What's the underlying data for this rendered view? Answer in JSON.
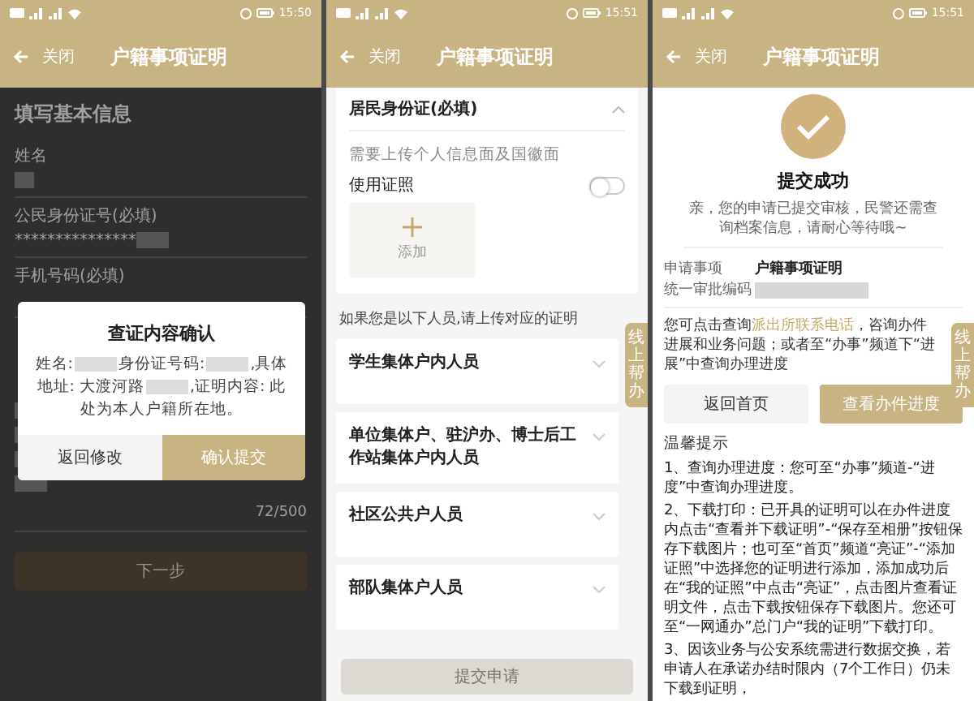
{
  "screens": [
    {
      "kind": "form_dialog",
      "status_time": "15:50",
      "nav": {
        "back": "关闭",
        "title": "户籍事项证明"
      },
      "heading": "填写基本信息",
      "fields": [
        {
          "label": "姓名",
          "redacted": true
        },
        {
          "label": "公民身份证号(必填)",
          "value": "***************",
          "redacted": true
        },
        {
          "label": "手机号码(必填)"
        }
      ],
      "remark": {
        "redacted": true,
        "counter": "72/500"
      },
      "next_button": "下一步",
      "dialog": {
        "title": "查证内容确认",
        "body": [
          {
            "kind": "text",
            "text": "姓名:"
          },
          {
            "kind": "redacted"
          },
          {
            "kind": "text",
            "text": "身份证号码:"
          },
          {
            "kind": "redacted"
          },
          {
            "kind": "text",
            "text": ",具体地址: 大渡河路"
          },
          {
            "kind": "redacted"
          },
          {
            "kind": "text",
            "text": ",证明内容: 此处为本人户籍所在地。"
          }
        ],
        "buttons": [
          {
            "label": "返回修改",
            "kind": "secondary"
          },
          {
            "label": "确认提交",
            "kind": "primary"
          }
        ]
      }
    },
    {
      "kind": "upload",
      "status_time": "15:51",
      "nav": {
        "back": "关闭",
        "title": "户籍事项证明"
      },
      "card": {
        "title": "居民身份证(必填)",
        "expanded": true,
        "hint": "需要上传个人信息面及国徽面",
        "toggle": {
          "label": "使用证照",
          "on": false
        },
        "upload_label": "添加"
      },
      "prompt": "如果您是以下人员,请上传对应的证明",
      "sections": [
        {
          "title": "学生集体户内人员",
          "expanded": false
        },
        {
          "title": "单位集体户、驻沪办、博士后工作站集体户内人员",
          "expanded": false
        },
        {
          "title": "社区公共户人员",
          "expanded": false
        },
        {
          "title": "部队集体户人员",
          "expanded": false
        }
      ],
      "submit": {
        "label": "提交申请",
        "disabled": true
      },
      "help_tab": "线上帮办"
    },
    {
      "kind": "success",
      "status_time": "15:51",
      "nav": {
        "back": "关闭",
        "title": "户籍事项证明"
      },
      "title": "提交成功",
      "message": "亲，您的申请已提交审核，民警还需查询档案信息，请耐心等待哦~",
      "details": [
        {
          "label": "申请事项",
          "value": "户籍事项证明"
        },
        {
          "label": "统一审批编码",
          "redacted": true
        }
      ],
      "notice": {
        "before": "您可点击查询",
        "link": "派出所联系电话",
        "after": "，咨询办件进展和业务问题；或者至“办事”频道下“进展”中查询办理进度"
      },
      "buttons": [
        {
          "label": "返回首页",
          "kind": "secondary"
        },
        {
          "label": "查看办件进度",
          "kind": "primary"
        }
      ],
      "tips_title": "温馨提示",
      "tips": [
        "1、查询办理进度：您可至“办事”频道-“进度”中查询办理进度。",
        "2、下载打印：已开具的证明可以在办件进度内点击“查看并下载证明”-“保存至相册”按钮保存下载图片；也可至“首页”频道“亮证”-“添加证照”中选择您的证明进行添加，添加成功后在“我的证照”中点击“亮证”，点击图片查看证明文件，点击下载按钮保存下载图片。您还可至“一网通办”总门户“我的证明”下载打印。",
        "3、因该业务与公安系统需进行数据交换，若申请人在承诺办结时限内（7个工作日）仍未下载到证明，"
      ],
      "help_tab": "线上帮办"
    }
  ]
}
